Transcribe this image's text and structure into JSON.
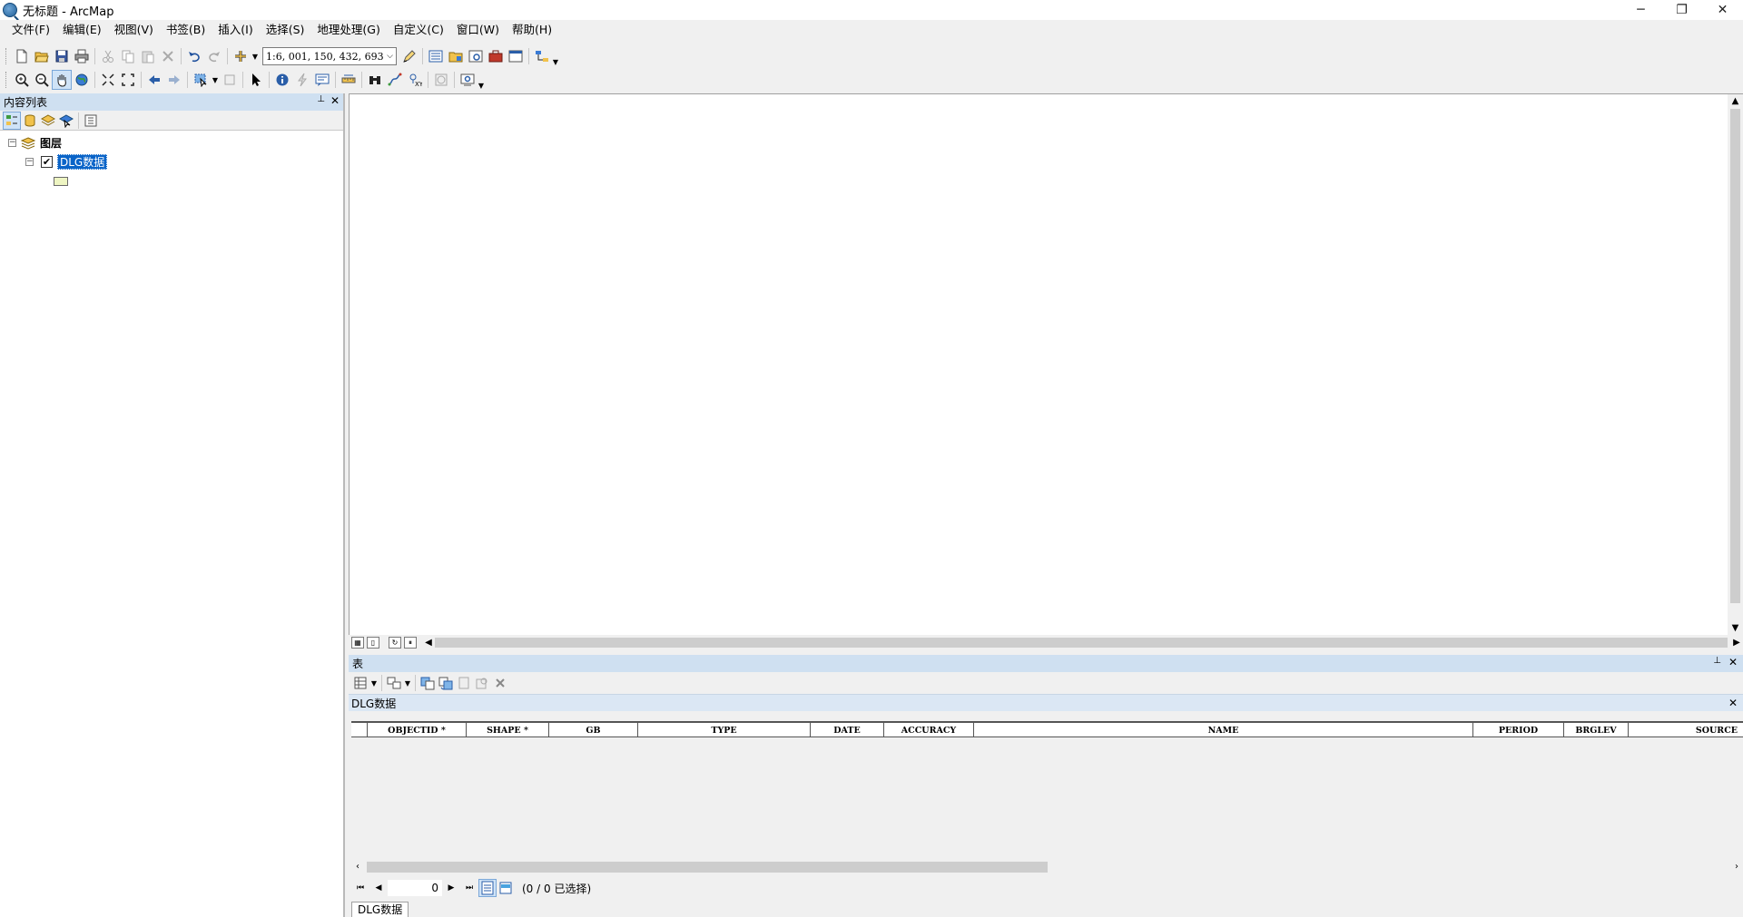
{
  "window": {
    "title": "无标题 - ArcMap",
    "minimize": "─",
    "restore": "❐",
    "close": "✕"
  },
  "menu": [
    "文件(F)",
    "编辑(E)",
    "视图(V)",
    "书签(B)",
    "插入(I)",
    "选择(S)",
    "地理处理(G)",
    "自定义(C)",
    "窗口(W)",
    "帮助(H)"
  ],
  "toolbar": {
    "scale": "1:6, 001, 150, 432, 693"
  },
  "toc": {
    "title": "内容列表",
    "pin": "📌",
    "close": "✕",
    "root_label": "图层",
    "layer_name": "DLG数据",
    "layer_checked": "✔"
  },
  "table_window": {
    "title": "表",
    "pin": "📌",
    "close": "✕",
    "table_name": "DLG数据",
    "table_close": "✕",
    "columns": [
      "OBJECTID *",
      "SHAPE *",
      "GB",
      "TYPE",
      "DATE",
      "ACCURACY",
      "NAME",
      "PERIOD",
      "BRGLEV",
      "SOURCE"
    ],
    "current_record": "0",
    "selection_status": "(0 / 0 已选择)",
    "tab_label": "DLG数据"
  },
  "colors": {
    "panel_header": "#cfe0f1",
    "selection": "#0a64c8",
    "legend_fill": "#eef5c2"
  }
}
